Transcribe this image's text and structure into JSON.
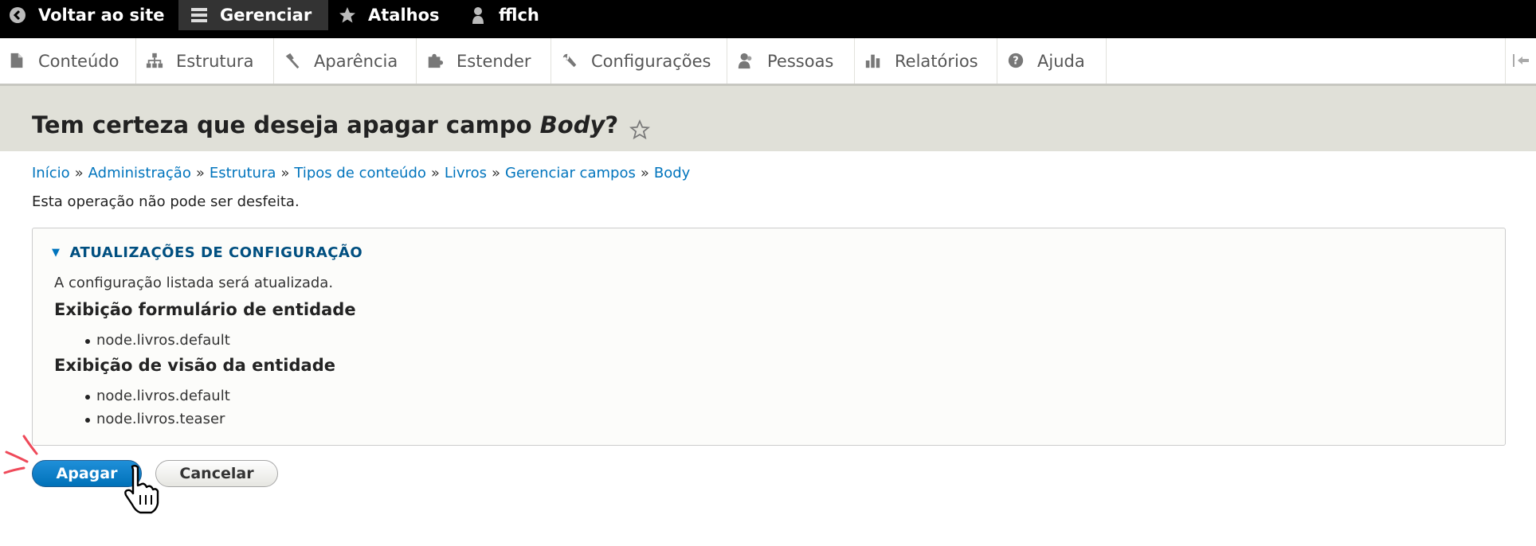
{
  "toolbar": {
    "back_label": "Voltar ao site",
    "manage_label": "Gerenciar",
    "shortcuts_label": "Atalhos",
    "user_label": "fflch"
  },
  "tray": {
    "items": [
      {
        "label": "Conteúdo",
        "icon": "file-icon"
      },
      {
        "label": "Estrutura",
        "icon": "sitemap-icon"
      },
      {
        "label": "Aparência",
        "icon": "paintbrush-icon"
      },
      {
        "label": "Estender",
        "icon": "puzzle-icon"
      },
      {
        "label": "Configurações",
        "icon": "wrench-icon"
      },
      {
        "label": "Pessoas",
        "icon": "people-icon"
      },
      {
        "label": "Relatórios",
        "icon": "bar-chart-icon"
      },
      {
        "label": "Ajuda",
        "icon": "help-icon"
      }
    ]
  },
  "page": {
    "title_prefix": "Tem certeza que deseja apagar campo ",
    "title_field": "Body",
    "title_suffix": "?"
  },
  "breadcrumb": [
    "Início",
    "Administração",
    "Estrutura",
    "Tipos de conteúdo",
    "Livros",
    "Gerenciar campos",
    "Body"
  ],
  "breadcrumb_separator": "»",
  "warning": "Esta operação não pode ser desfeita.",
  "details": {
    "summary": "ATUALIZAÇÕES DE CONFIGURAÇÃO",
    "description": "A configuração listada será atualizada.",
    "groups": [
      {
        "heading": "Exibição formulário de entidade",
        "items": [
          "node.livros.default"
        ]
      },
      {
        "heading": "Exibição de visão da entidade",
        "items": [
          "node.livros.default",
          "node.livros.teaser"
        ]
      }
    ]
  },
  "actions": {
    "delete_label": "Apagar",
    "cancel_label": "Cancelar"
  },
  "colors": {
    "link": "#0074bd",
    "primary_button": "#0071b8",
    "header_band": "#e0e0d8",
    "click_marks": "#ef4a5a"
  }
}
